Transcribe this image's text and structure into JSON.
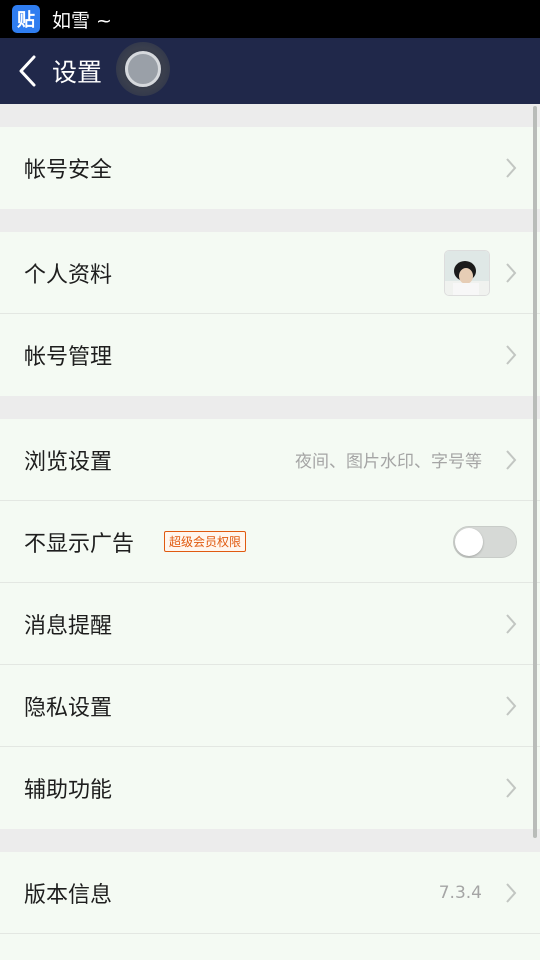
{
  "status_bar": {
    "app_badge": "贴",
    "notification_text": "如雪 ~"
  },
  "header": {
    "title": "设置"
  },
  "groups": [
    [
      {
        "label": "帐号安全"
      }
    ],
    [
      {
        "label": "个人资料"
      },
      {
        "label": "帐号管理"
      }
    ],
    [
      {
        "label": "浏览设置",
        "hint": "夜间、图片水印、字号等"
      },
      {
        "label": "不显示广告",
        "badge": "超级会员权限",
        "toggle_on": false
      },
      {
        "label": "消息提醒"
      },
      {
        "label": "隐私设置"
      },
      {
        "label": "辅助功能"
      }
    ],
    [
      {
        "label": "版本信息",
        "hint": "7.3.4"
      }
    ]
  ],
  "colors": {
    "header_bg": "#20284a",
    "row_bg": "#f4faf3",
    "badge_color": "#e05a10"
  },
  "icons": [
    "back-arrow-icon",
    "floating-ball-icon",
    "chevron-right-icon",
    "avatar-image"
  ]
}
